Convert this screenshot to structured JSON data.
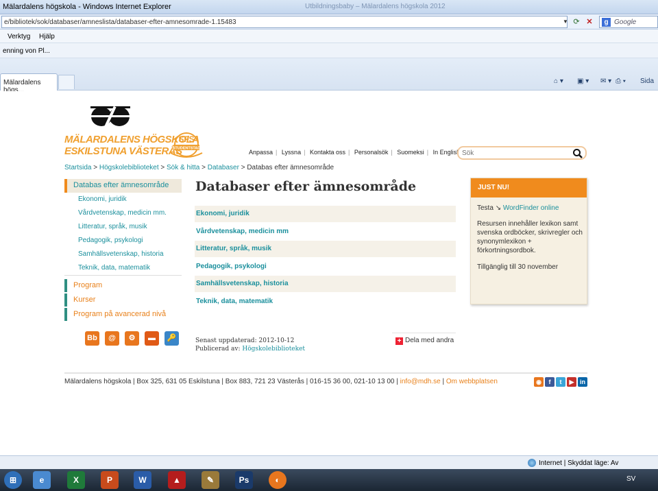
{
  "browser": {
    "window_title": "Mälardalens högskola - Windows Internet Explorer",
    "ghost_title": "Utbildningsbaby – Mälardalens högskola 2012",
    "address": "e/bibliotek/sok/databaser/amneslista/databaser-efter-amnesomrade-1.15483",
    "search_engine": "Google",
    "menu": [
      "Verktyg",
      "Hjälp"
    ],
    "favorites_item": "enning von Pl...",
    "tab_label": "Mälardalens högs...",
    "command_page": "Sida"
  },
  "site": {
    "logo_lines": [
      "MÄLARDALENS HÖGSKOLA",
      "ESKILSTUNA VÄSTERÅS"
    ],
    "badge": {
      "text": "SFS",
      "sub": "STUDENTSTAD"
    },
    "top_links": [
      "Anpassa",
      "Lyssna",
      "Kontakta oss",
      "Personalsök",
      "Suomeksi",
      "In English"
    ],
    "search_placeholder": "Sök"
  },
  "breadcrumb": {
    "items": [
      "Startsida",
      "Högskolebiblioteket",
      "Sök & hitta",
      "Databaser"
    ],
    "current": "Databas efter ämnesområde",
    "separator": ">"
  },
  "leftnav": {
    "active": "Databas efter ämnesområde",
    "sub_items": [
      "Ekonomi, juridik",
      "Vårdvetenskap, medicin mm.",
      "Litteratur, språk, musik",
      "Pedagogik, psykologi",
      "Samhällsvetenskap, historia",
      "Teknik, data, matematik"
    ],
    "main_items": [
      "Program",
      "Kurser",
      "Program på avancerad nivå"
    ],
    "tools": [
      {
        "label": "Bb",
        "color": "#e8761e"
      },
      {
        "label": "@",
        "color": "#e8761e"
      },
      {
        "label": "⚙",
        "color": "#e8761e"
      },
      {
        "label": "▬",
        "color": "#e05a16"
      },
      {
        "label": "🔑",
        "color": "#3a86c8"
      }
    ]
  },
  "main": {
    "title": "Databaser efter ämnesområde",
    "categories": [
      "Ekonomi, juridik",
      "Vårdvetenskap, medicin mm",
      "Litteratur, språk, musik",
      "Pedagogik, psykologi",
      "Samhällsvetenskap, historia",
      "Teknik, data, matematik"
    ],
    "updated_label": "Senast uppdaterad:",
    "updated_date": "2012-10-12",
    "published_label": "Publicerad av:",
    "published_by": "Högskolebiblioteket",
    "share_label": "Dela med andra"
  },
  "justnu": {
    "heading": "JUST NU!",
    "intro_text": "Testa",
    "intro_link": "WordFinder online",
    "description": "Resursen innehåller lexikon samt svenska ordböcker, skrivregler och synonymlexikon + förkortningsordbok.",
    "availability": "Tillgänglig till 30 november"
  },
  "footer": {
    "address": "Mälardalens högskola | Box 325, 631 05 Eskilstuna | Box 883, 721 23 Västerås | 016-15 36 00, 021-10 13 00 |",
    "email": "info@mdh.se",
    "about": "Om webbplatsen",
    "social": [
      {
        "name": "rss-icon",
        "label": "◉",
        "color": "#e8761e"
      },
      {
        "name": "facebook-icon",
        "label": "f",
        "color": "#3b5998"
      },
      {
        "name": "twitter-icon",
        "label": "t",
        "color": "#3aa5d8"
      },
      {
        "name": "youtube-icon",
        "label": "▶",
        "color": "#c4302b"
      },
      {
        "name": "linkedin-icon",
        "label": "in",
        "color": "#0a66a8"
      }
    ]
  },
  "status": {
    "zone": "Internet | Skyddat läge: Av",
    "language": "SV"
  },
  "taskbar": [
    {
      "name": "start-icon",
      "label": "⊞",
      "color": "#2f6fb8"
    },
    {
      "name": "ie-icon",
      "label": "e",
      "color": "#4a8ad0"
    },
    {
      "name": "excel-icon",
      "label": "X",
      "color": "#1f7a3a"
    },
    {
      "name": "powerpoint-icon",
      "label": "P",
      "color": "#c84b1c"
    },
    {
      "name": "word-icon",
      "label": "W",
      "color": "#2a5ca8"
    },
    {
      "name": "pdf-icon",
      "label": "▲",
      "color": "#b51d1d"
    },
    {
      "name": "paint-icon",
      "label": "✎",
      "color": "#9a7a3a"
    },
    {
      "name": "photoshop-icon",
      "label": "Ps",
      "color": "#1a3a6a"
    },
    {
      "name": "firefox-icon",
      "label": "◐",
      "color": "#e8761e"
    }
  ]
}
